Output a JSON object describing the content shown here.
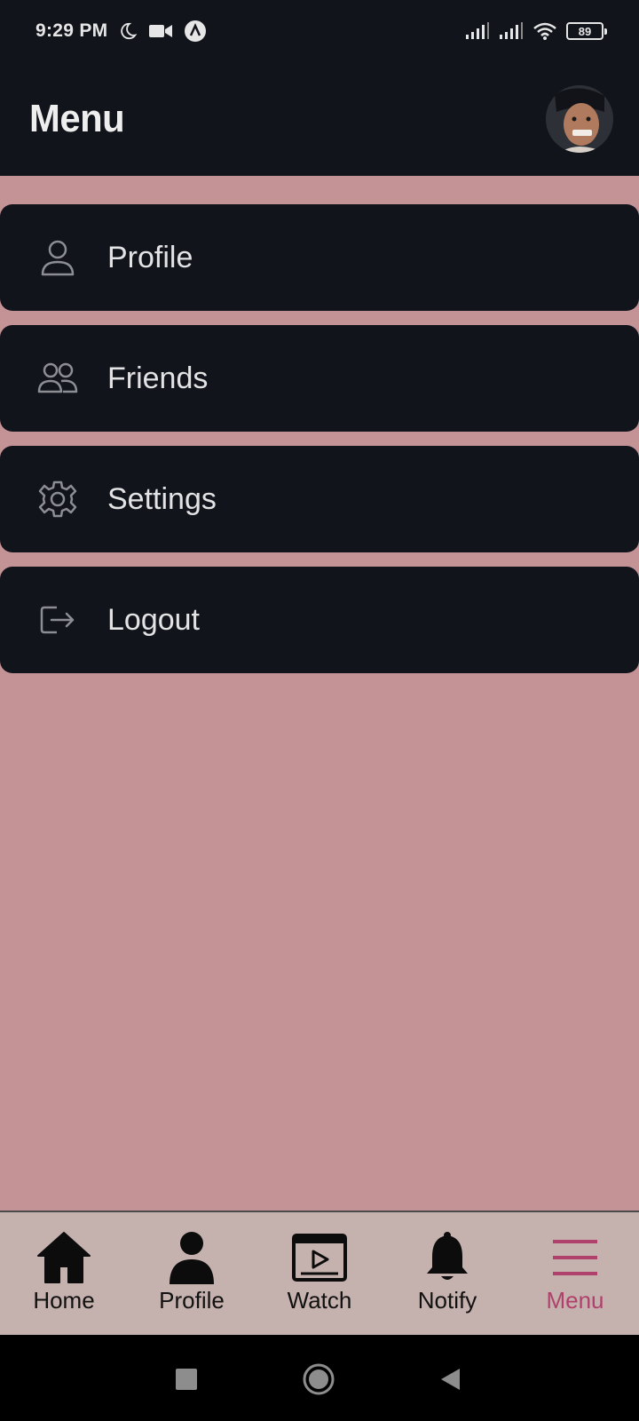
{
  "status_bar": {
    "time": "9:29 PM",
    "left_icons": [
      "moon-icon",
      "video-camera-icon",
      "app-circle-icon"
    ],
    "right_icons": [
      "signal-icon",
      "signal-icon",
      "wifi-icon"
    ],
    "battery": "89"
  },
  "header": {
    "title": "Menu",
    "avatar": "avatar"
  },
  "menu": {
    "items": [
      {
        "label": "Profile",
        "icon": "user-icon"
      },
      {
        "label": "Friends",
        "icon": "users-icon"
      },
      {
        "label": "Settings",
        "icon": "gear-icon"
      },
      {
        "label": "Logout",
        "icon": "logout-icon"
      }
    ]
  },
  "bottom_nav": {
    "items": [
      {
        "label": "Home",
        "icon": "home-icon"
      },
      {
        "label": "Profile",
        "icon": "user-icon"
      },
      {
        "label": "Watch",
        "icon": "play-icon"
      },
      {
        "label": "Notify",
        "icon": "bell-icon"
      },
      {
        "label": "Menu",
        "icon": "menu-icon",
        "active": true
      }
    ]
  },
  "system_nav": [
    "recents-button",
    "home-button",
    "back-button"
  ],
  "colors": {
    "background": "#c49396",
    "bar": "#12141b",
    "nav_background": "#c5b1ad",
    "accent": "#b0416c"
  }
}
